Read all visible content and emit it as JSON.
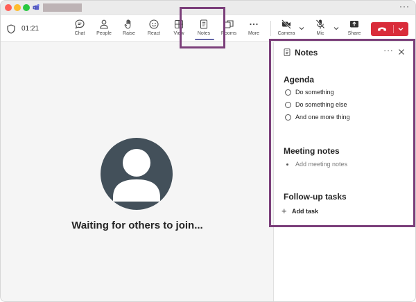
{
  "window": {
    "meeting_timer": "01:21"
  },
  "toolbar": {
    "buttons": [
      {
        "label": "Chat"
      },
      {
        "label": "People"
      },
      {
        "label": "Raise"
      },
      {
        "label": "React"
      },
      {
        "label": "View"
      },
      {
        "label": "Notes"
      },
      {
        "label": "Rooms"
      },
      {
        "label": "More"
      },
      {
        "label": "Camera"
      },
      {
        "label": "Mic"
      },
      {
        "label": "Share"
      }
    ],
    "active_button": "Notes",
    "leave_color": "#d92c3a",
    "accent_color": "#6264a7"
  },
  "stage": {
    "waiting_text": "Waiting for others to join..."
  },
  "notes_panel": {
    "title": "Notes",
    "agenda": {
      "heading": "Agenda",
      "items": [
        "Do something",
        "Do something else",
        "And one more thing"
      ]
    },
    "meeting_notes": {
      "heading": "Meeting notes",
      "placeholder": "Add meeting notes"
    },
    "follow_up": {
      "heading": "Follow-up tasks",
      "add_label": "Add task"
    }
  },
  "highlight_color": "#7b3f7a"
}
